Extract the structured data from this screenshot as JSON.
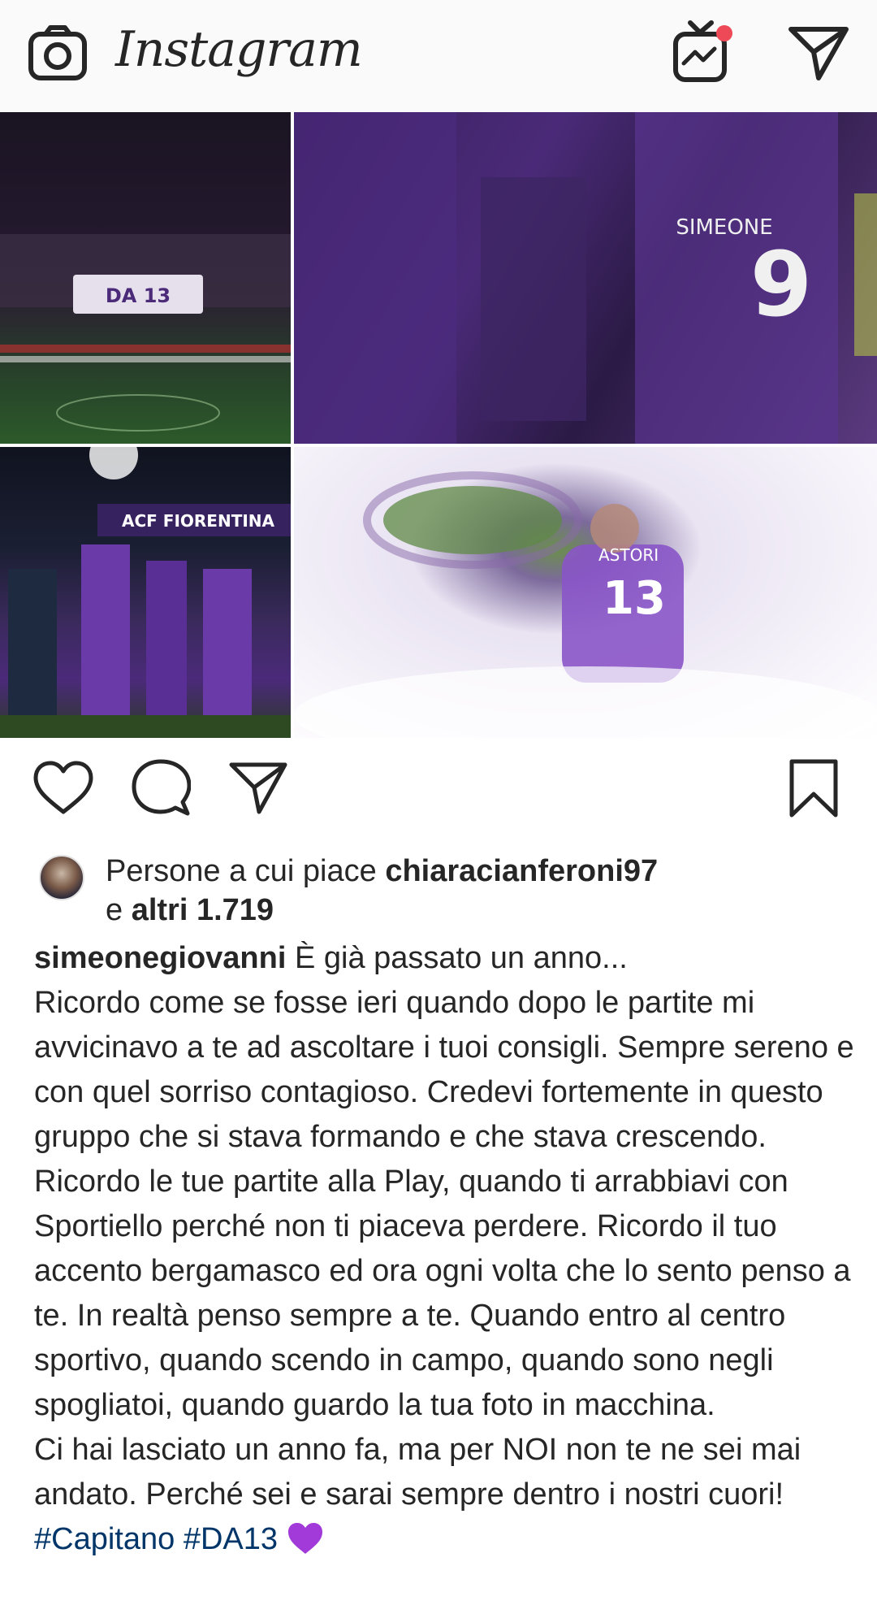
{
  "header": {
    "logo_text": "Instagram",
    "camera_icon": "camera-icon",
    "igtv_icon": "igtv-icon",
    "direct_icon": "direct-message-icon",
    "igtv_badge_color": "#ed4956"
  },
  "post": {
    "images": [
      {
        "name": "stadium-banner-photo"
      },
      {
        "name": "players-hug-photo"
      },
      {
        "name": "team-salute-photo"
      },
      {
        "name": "tribute-clouds-photo"
      }
    ],
    "image_text": {
      "banner": "DA 13",
      "jersey_number": "9",
      "jersey_name": "SIMEONE",
      "fiorentina_board": "ACF FIORENTINA",
      "tribute_name": "ASTORI",
      "tribute_number": "13"
    },
    "actions": {
      "like_icon": "heart-icon",
      "comment_icon": "comment-icon",
      "share_icon": "share-icon",
      "save_icon": "bookmark-icon"
    },
    "likes": {
      "prefix": "Persone a cui piace ",
      "user": "chiaracianferoni97",
      "middle": "e ",
      "others": "altri 1.719"
    },
    "caption": {
      "username": "simeonegiovanni",
      "text": " È già passato un anno...\nRicordo come se fosse ieri quando dopo le partite mi avvicinavo a te ad ascoltare i tuoi consigli. Sempre sereno e con quel sorriso contagioso. Credevi fortemente in questo gruppo che si stava formando e che stava crescendo. Ricordo le tue partite alla Play, quando ti arrabbiavi con Sportiello perché non ti piaceva perdere. Ricordo il tuo accento bergamasco ed ora ogni volta che lo sento penso a te. In realtà penso sempre a te. Quando entro al centro sportivo, quando scendo in campo, quando sono negli spogliatoi, quando guardo la tua foto in macchina.\nCi hai lasciato un anno fa, ma per NOI non te ne sei mai andato. Perché sei e sarai sempre dentro i nostri cuori! ",
      "hashtag1": "#Capitano",
      "hashtag2": "#DA13",
      "emoji": "purple-heart-icon"
    }
  }
}
